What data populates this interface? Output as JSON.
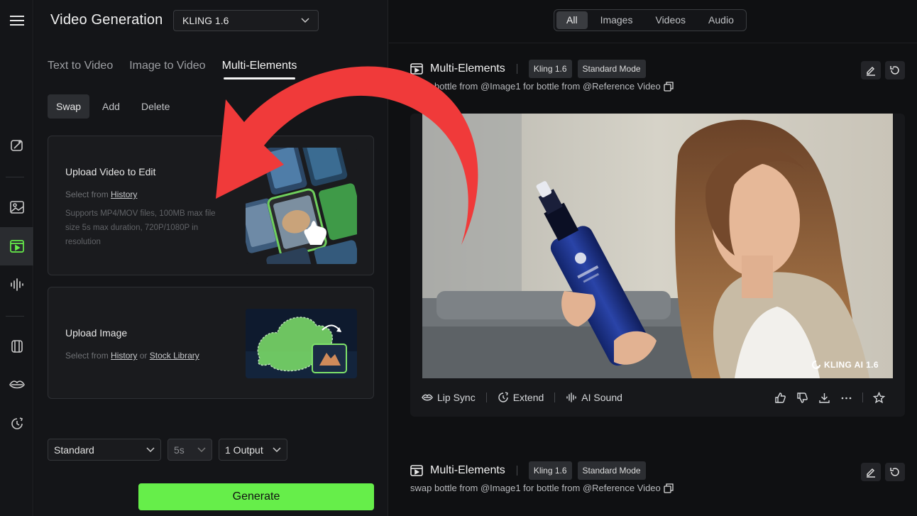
{
  "app": {
    "title": "Video Generation",
    "model": "KLING 1.6"
  },
  "rail": {
    "icons": [
      "menu-icon",
      "pen-sparkle-icon",
      "image-icon",
      "video-icon",
      "audio-wave-icon",
      "box-icon",
      "lips-icon",
      "history-icon"
    ],
    "active": "video-icon"
  },
  "panel": {
    "tabs": [
      "Text to Video",
      "Image to Video",
      "Multi-Elements"
    ],
    "active_tab": "Multi-Elements",
    "subtabs": [
      "Swap",
      "Add",
      "Delete"
    ],
    "active_subtab": "Swap",
    "upload_video": {
      "title": "Upload Video to Edit",
      "select_prefix": "Select from",
      "history_link": "History",
      "desc": "Supports MP4/MOV files, 100MB max file size 5s max duration, 720P/1080P in resolution"
    },
    "upload_image": {
      "title": "Upload Image",
      "select_prefix": "Select from",
      "history_link": "History",
      "or_text": "or",
      "stock_link": "Stock Library"
    },
    "mode": "Standard",
    "duration": "5s",
    "outputs": "1 Output",
    "generate_label": "Generate"
  },
  "filters": {
    "items": [
      "All",
      "Images",
      "Videos",
      "Audio"
    ],
    "active": "All"
  },
  "tasks": [
    {
      "title": "Multi-Elements",
      "chip_model": "Kling 1.6",
      "chip_mode": "Standard Mode",
      "prompt": "swap bottle from @Image1 for bottle from @Reference Video",
      "watermark": "KLING AI 1.6",
      "actions": {
        "lip_sync": "Lip Sync",
        "extend": "Extend",
        "ai_sound": "AI Sound"
      }
    },
    {
      "title": "Multi-Elements",
      "chip_model": "Kling 1.6",
      "chip_mode": "Standard Mode",
      "prompt": "swap bottle from @Image1 for bottle from @Reference Video"
    }
  ],
  "colors": {
    "accent_green": "#66ee4a",
    "arrow_red": "#f03a3a",
    "background": "#0f1012"
  }
}
